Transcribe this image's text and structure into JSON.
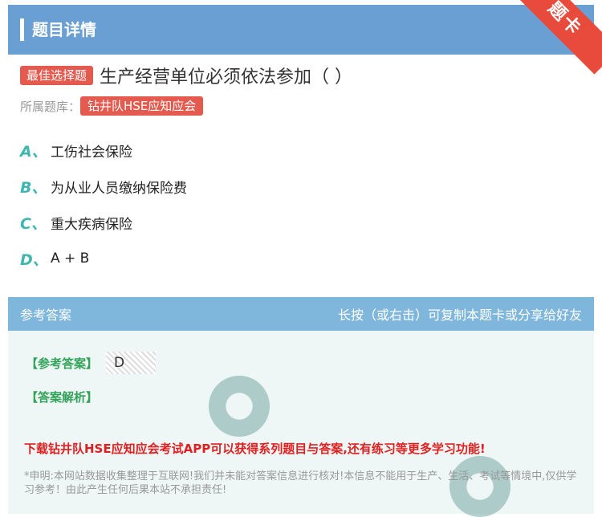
{
  "header": {
    "title": "题目详情",
    "ribbon": "题卡"
  },
  "question": {
    "type_tag": "最佳选择题",
    "stem": "生产经营单位必须依法参加（ ）",
    "bank_label": "所属题库：",
    "bank_name": "钻井队HSE应知应会"
  },
  "options": [
    {
      "letter": "A、",
      "text": "工伤社会保险"
    },
    {
      "letter": "B、",
      "text": "为从业人员缴纳保险费"
    },
    {
      "letter": "C、",
      "text": "重大疾病保险"
    },
    {
      "letter": "D、",
      "text": "A + B"
    }
  ],
  "answer": {
    "head_left": "参考答案",
    "head_right": "长按（或右击）可复制本题卡或分享给好友",
    "answer_label": "【参考答案】",
    "answer_value": "D",
    "analysis_label": "【答案解析】",
    "promo": "下载钻井队HSE应知应会考试APP可以获得系列题目与答案,还有练习等更多学习功能!",
    "disclaimer": "*申明:本网站数据收集整理于互联网!我们并未能对答案信息进行核对!本信息不能用于生产、生活、考试等情境中,仅供学习参考！由此产生任何后果本站不承担责任!"
  },
  "colors": {
    "header_bg": "#6a9fd4",
    "ribbon": "#e84b3c",
    "tag": "#e45a4e",
    "option_letter": "#3fb6b0",
    "answer_head_bg": "#7fb7dc",
    "answer_green": "#33a35a",
    "promo_red": "#e02020"
  }
}
